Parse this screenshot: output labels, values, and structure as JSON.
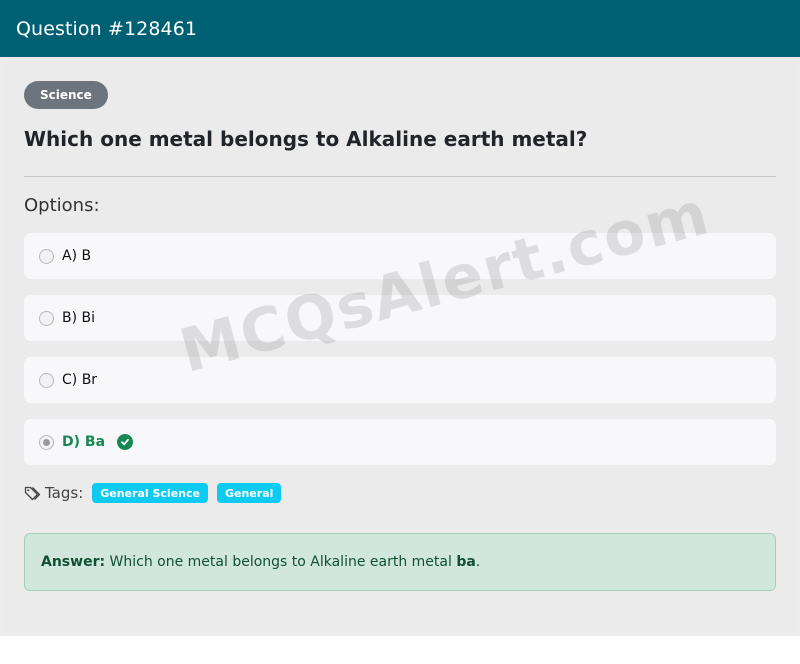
{
  "header": {
    "title": "Question #128461"
  },
  "category": "Science",
  "question": "Which one metal belongs to Alkaline earth metal?",
  "options_heading": "Options:",
  "options": [
    {
      "label": "A) B",
      "selected": false,
      "correct": false
    },
    {
      "label": "B) Bi",
      "selected": false,
      "correct": false
    },
    {
      "label": "C) Br",
      "selected": false,
      "correct": false
    },
    {
      "label": "D) Ba",
      "selected": true,
      "correct": true
    }
  ],
  "tags": {
    "label": "Tags:",
    "items": [
      "General Science",
      "General"
    ]
  },
  "answer": {
    "prefix": "Answer:",
    "text": " Which one metal belongs to Alkaline earth metal ",
    "value": "ba",
    "suffix": "."
  },
  "watermark": "MCQsAlert.com",
  "colors": {
    "header": "#006073",
    "correct": "#198754",
    "tag": "#0dcaf0",
    "answer_bg": "#d1e7dd"
  }
}
